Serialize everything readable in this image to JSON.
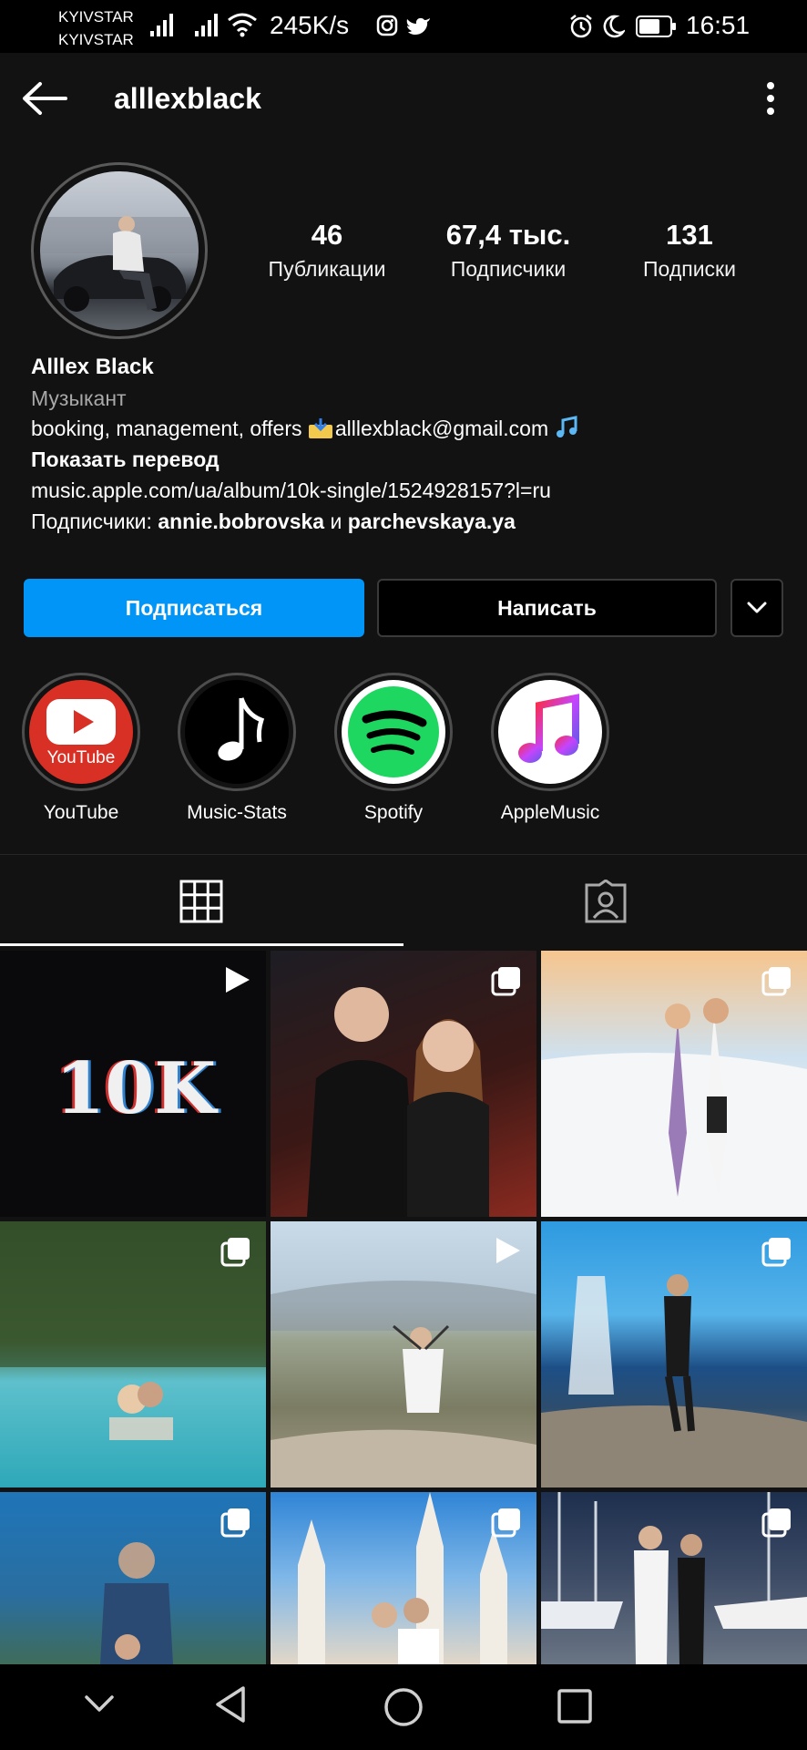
{
  "status_bar": {
    "carrier1": "KYIVSTAR",
    "carrier2": "KYIVSTAR",
    "speed": "245K/s",
    "time": "16:51"
  },
  "header": {
    "username": "alllexblack"
  },
  "stats": [
    {
      "value": "46",
      "label": "Публикации"
    },
    {
      "value": "67,4 тыс.",
      "label": "Подписчики"
    },
    {
      "value": "131",
      "label": "Подписки"
    }
  ],
  "bio": {
    "name": "Alllex Black",
    "category": "Музыкант",
    "line_prefix": "booking, management, offers ",
    "email": "alllexblack@gmail.com",
    "translate": "Показать перевод",
    "link": "music.apple.com/ua/album/10k-single/1524928157?l=ru",
    "followers_prefix": "Подписчики: ",
    "follower1": "annie.bobrovska",
    "and": " и ",
    "follower2": "parchevskaya.ya"
  },
  "buttons": {
    "follow": "Подписаться",
    "message": "Написать"
  },
  "highlights": [
    {
      "label": "YouTube",
      "inner_text": "YouTube"
    },
    {
      "label": "Music-Stats"
    },
    {
      "label": "Spotify"
    },
    {
      "label": "AppleMusic"
    }
  ],
  "grid_thumb_text": "10K",
  "colors": {
    "accent": "#0095f6",
    "background": "#121212"
  },
  "icons": [
    "back-arrow-icon",
    "more-vertical-icon",
    "grid-icon",
    "tagged-icon",
    "play-icon",
    "multi-post-icon"
  ]
}
